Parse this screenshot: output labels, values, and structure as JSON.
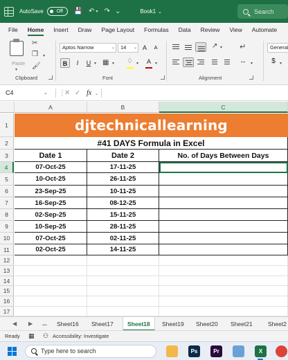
{
  "titlebar": {
    "autosave_label": "AutoSave",
    "autosave_state": "Off",
    "book_name": "Book1",
    "search_placeholder": "Search"
  },
  "menu": [
    "File",
    "Home",
    "Insert",
    "Draw",
    "Page Layout",
    "Formulas",
    "Data",
    "Review",
    "View",
    "Automate"
  ],
  "menu_active": "Home",
  "ribbon": {
    "paste_label": "Paste",
    "clipboard_label": "Clipboard",
    "font_name": "Aptos Narrow",
    "font_size": "14",
    "grow_font": "A",
    "shrink_font": "A",
    "bold": "B",
    "italic": "I",
    "underline": "U",
    "font_color_glyph": "A",
    "font_label": "Font",
    "alignment_label": "Alignment",
    "number_format": "General",
    "currency_glyph": "$",
    "font_color_accent": "#c00000",
    "fill_color_accent": "#ffff00"
  },
  "formula_bar": {
    "cell_ref": "C4",
    "fx": "fx",
    "value": ""
  },
  "sheet": {
    "columns": [
      "A",
      "B",
      "C"
    ],
    "banner": "djtechnicallearning",
    "banner_color": "#ed7d31",
    "subtitle": "#41 DAYS Formula in Excel",
    "headers": [
      "Date 1",
      "Date 2",
      "No. of Days Between Days"
    ],
    "rows": [
      [
        "07-Oct-25",
        "17-11-25",
        ""
      ],
      [
        "10-Oct-25",
        "26-11-25",
        ""
      ],
      [
        "23-Sep-25",
        "10-11-25",
        ""
      ],
      [
        "16-Sep-25",
        "08-12-25",
        ""
      ],
      [
        "02-Sep-25",
        "15-11-25",
        ""
      ],
      [
        "10-Sep-25",
        "28-11-25",
        ""
      ],
      [
        "07-Oct-25",
        "02-11-25",
        ""
      ],
      [
        "02-Oct-25",
        "14-11-25",
        ""
      ]
    ],
    "row_numbers": [
      "1",
      "2",
      "3",
      "4",
      "5",
      "6",
      "7",
      "8",
      "9",
      "10",
      "11",
      "12",
      "13",
      "14",
      "15",
      "16",
      "17"
    ],
    "selected_cell": "C4"
  },
  "tabs": {
    "ellipsis": "...",
    "items": [
      "Sheet16",
      "Sheet17",
      "Sheet18",
      "Sheet19",
      "Sheet20",
      "Sheet21",
      "Sheet2"
    ],
    "active": "Sheet18"
  },
  "status": {
    "ready": "Ready",
    "accessibility": "Accessibility: Investigate"
  },
  "taskbar": {
    "search_placeholder": "Type here to search",
    "apps": [
      {
        "name": "file-explorer",
        "glyph": "",
        "color": "#f2b84b"
      },
      {
        "name": "photoshop",
        "glyph": "Ps",
        "color": "#0b2a4a"
      },
      {
        "name": "premiere-pro",
        "glyph": "Pr",
        "color": "#2a0a3d"
      },
      {
        "name": "notepad",
        "glyph": "",
        "color": "#6aa0d8"
      },
      {
        "name": "excel",
        "glyph": "X",
        "color": "#1e7145"
      },
      {
        "name": "chrome",
        "glyph": "",
        "color": "#db4437"
      },
      {
        "name": "edge",
        "glyph": "",
        "color": "#0c8fd6"
      }
    ]
  }
}
